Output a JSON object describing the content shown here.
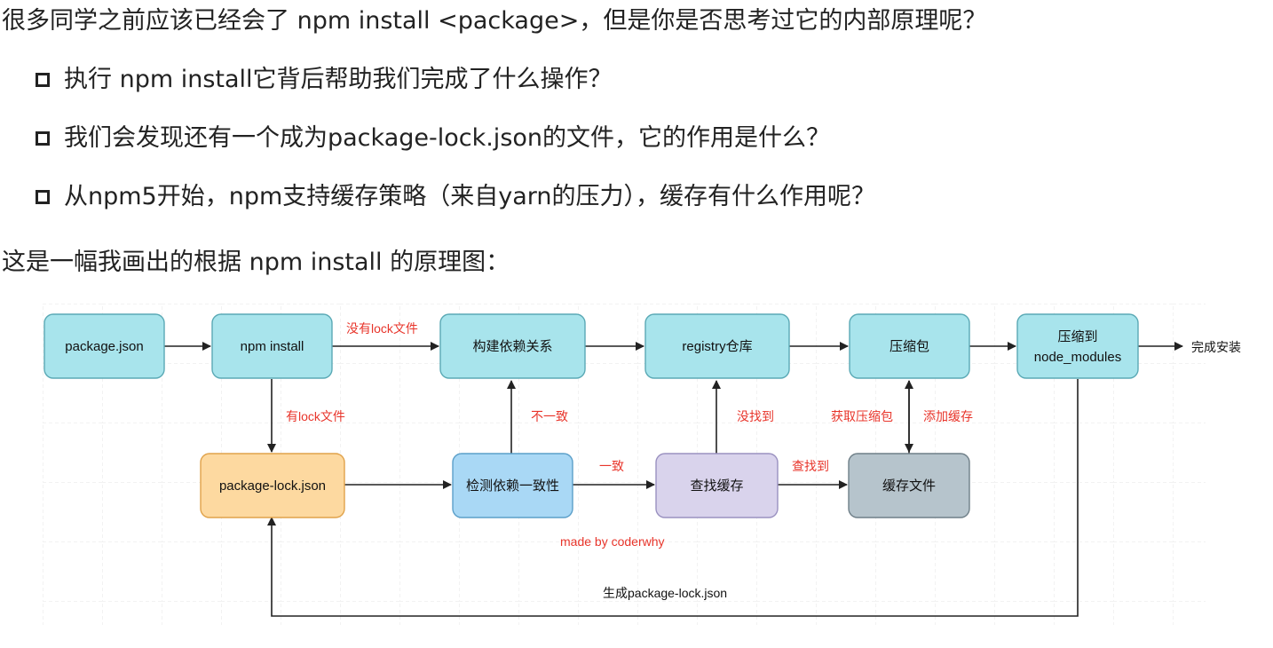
{
  "intro": "很多同学之前应该已经会了 npm install <package>，但是你是否思考过它的内部原理呢？",
  "questions": [
    "执行 npm install它背后帮助我们完成了什么操作？",
    "我们会发现还有一个成为package-lock.json的文件，它的作用是什么？",
    "从npm5开始，npm支持缓存策略（来自yarn的压力），缓存有什么作用呢？"
  ],
  "diagram_caption": "这是一幅我画出的根据 npm install 的原理图：",
  "diagram": {
    "nodes": {
      "package_json": "package.json",
      "npm_install": "npm install",
      "build_deps": "构建依赖关系",
      "registry": "registry仓库",
      "compressed": "压缩包",
      "extract_line1": "压缩到",
      "extract_line2": "node_modules",
      "lock_json": "package-lock.json",
      "check_consistency": "检测依赖一致性",
      "find_cache": "查找缓存",
      "cache_files": "缓存文件"
    },
    "edge_labels": {
      "no_lock": "没有lock文件",
      "has_lock": "有lock文件",
      "inconsistent": "不一致",
      "consistent": "一致",
      "not_found": "没找到",
      "found": "查找到",
      "get_package": "获取压缩包",
      "add_cache": "添加缓存",
      "generate_lock": "生成package-lock.json"
    },
    "end_label": "完成安装",
    "credit": "made by coderwhy",
    "colors": {
      "teal": "#a8e4ec",
      "teal_border": "#5aa9b5",
      "orange": "#fdd9a0",
      "orange_border": "#e0a24a",
      "blue": "#a9d8f5",
      "blue_border": "#5b9fc9",
      "purple": "#d9d3ec",
      "purple_border": "#9a91c0",
      "gray": "#b6c4cc",
      "gray_border": "#6f7f88",
      "red_label": "#e8352b"
    }
  }
}
